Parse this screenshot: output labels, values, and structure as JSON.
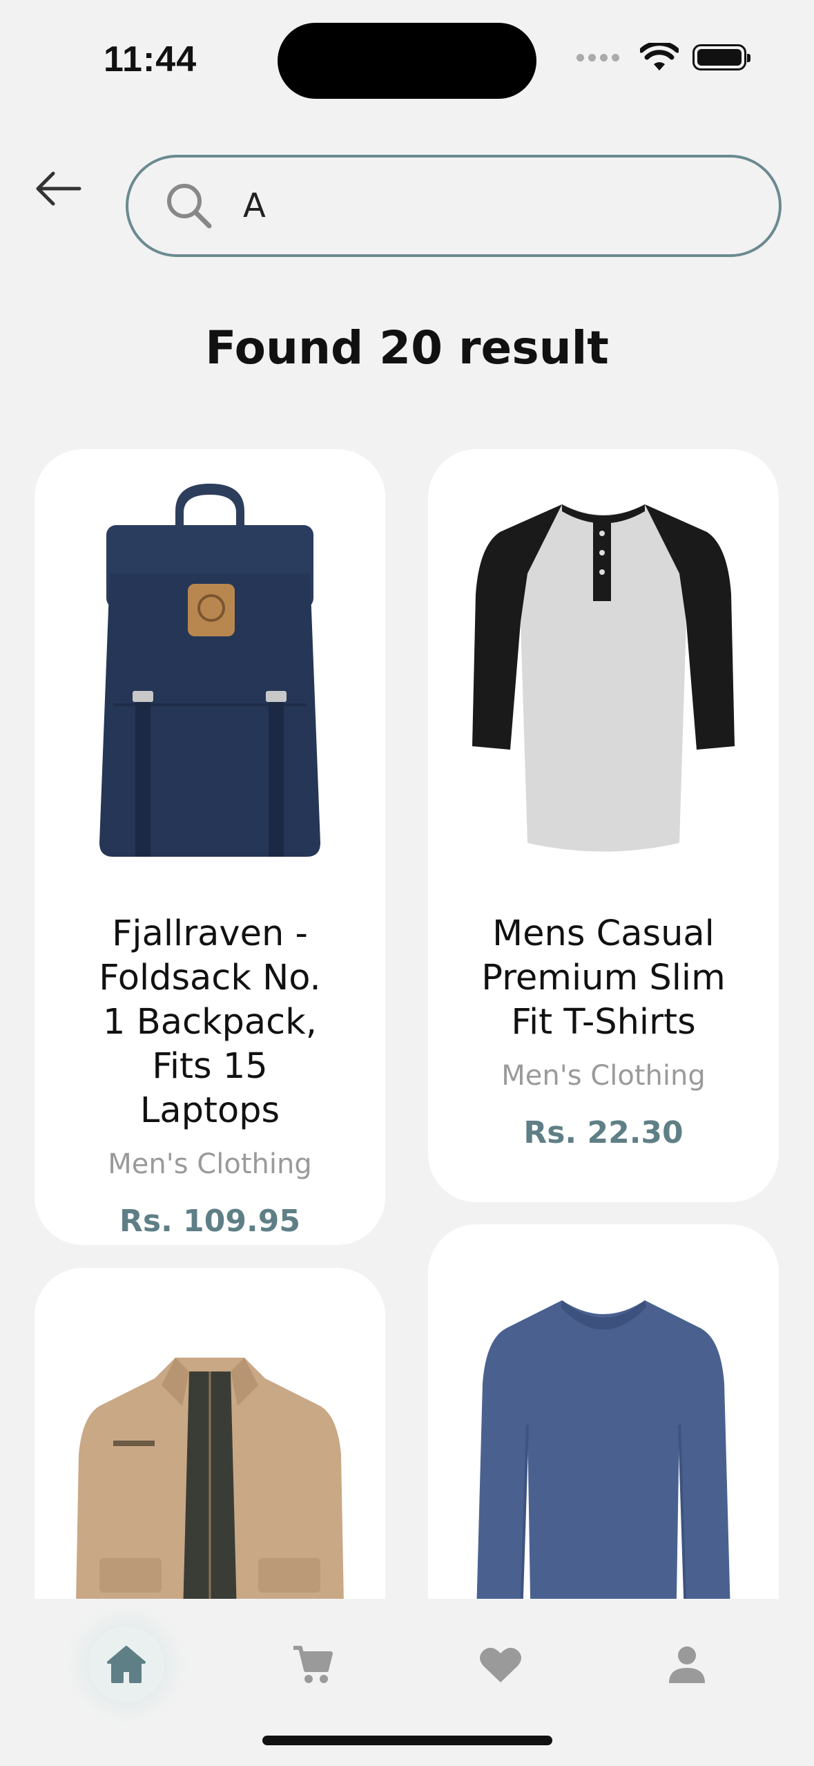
{
  "status": {
    "time": "11:44"
  },
  "search": {
    "value": "A",
    "placeholder": "Search"
  },
  "results": {
    "title": "Found 20 result"
  },
  "products": [
    {
      "title": "Fjallraven - Foldsack No. 1 Backpack, Fits 15 Laptops",
      "category": "Men's Clothing",
      "price": "Rs. 109.95",
      "image": "backpack-image"
    },
    {
      "title": "Mens Casual Premium Slim Fit T-Shirts",
      "category": "Men's Clothing",
      "price": "Rs. 22.30",
      "image": "raglan-tshirt-image"
    },
    {
      "title": "",
      "category": "",
      "price": "",
      "image": "jacket-image"
    },
    {
      "title": "",
      "category": "",
      "price": "",
      "image": "long-sleeve-shirt-image"
    }
  ],
  "nav": {
    "items": [
      {
        "name": "home",
        "icon": "home-icon",
        "active": true
      },
      {
        "name": "cart",
        "icon": "cart-icon",
        "active": false
      },
      {
        "name": "favorites",
        "icon": "heart-icon",
        "active": false
      },
      {
        "name": "profile",
        "icon": "person-icon",
        "active": false
      }
    ]
  },
  "colors": {
    "accent": "#5f7f86",
    "border": "#6b8a90",
    "background": "#f2f2f2",
    "card": "#ffffff"
  }
}
